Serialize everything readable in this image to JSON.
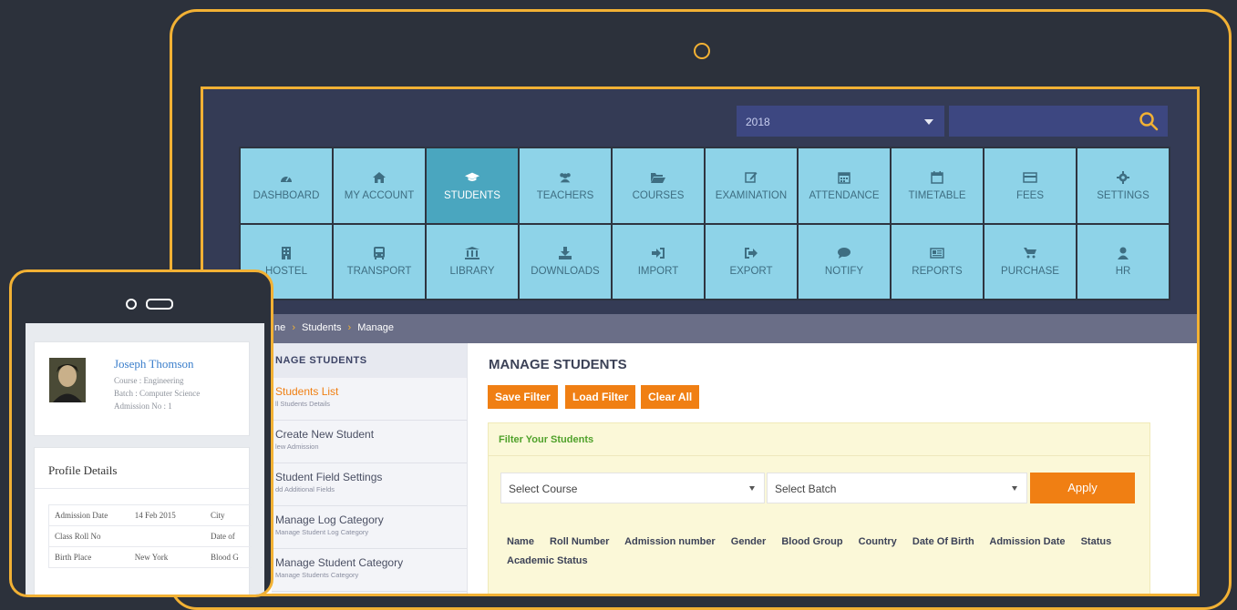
{
  "header": {
    "year_value": "2018",
    "search_placeholder": ""
  },
  "nav": {
    "row1": [
      {
        "label": "DASHBOARD",
        "icon": "dashboard-icon"
      },
      {
        "label": "MY ACCOUNT",
        "icon": "home-icon"
      },
      {
        "label": "STUDENTS",
        "icon": "graduation-cap-icon",
        "active": true
      },
      {
        "label": "TEACHERS",
        "icon": "users-icon"
      },
      {
        "label": "COURSES",
        "icon": "folder-open-icon"
      },
      {
        "label": "EXAMINATION",
        "icon": "edit-icon"
      },
      {
        "label": "ATTENDANCE",
        "icon": "calendar-icon"
      },
      {
        "label": "TIMETABLE",
        "icon": "calendar-outline-icon"
      },
      {
        "label": "FEES",
        "icon": "credit-card-icon"
      },
      {
        "label": "SETTINGS",
        "icon": "gear-icon"
      }
    ],
    "row2": [
      {
        "label": "HOSTEL",
        "icon": "building-icon"
      },
      {
        "label": "TRANSPORT",
        "icon": "bus-icon"
      },
      {
        "label": "LIBRARY",
        "icon": "institution-icon"
      },
      {
        "label": "DOWNLOADS",
        "icon": "download-icon"
      },
      {
        "label": "IMPORT",
        "icon": "sign-in-icon"
      },
      {
        "label": "EXPORT",
        "icon": "sign-out-icon"
      },
      {
        "label": "NOTIFY",
        "icon": "comment-icon"
      },
      {
        "label": "REPORTS",
        "icon": "newspaper-icon"
      },
      {
        "label": "PURCHASE",
        "icon": "shopping-cart-icon"
      },
      {
        "label": "HR",
        "icon": "user-icon"
      }
    ]
  },
  "breadcrumb": {
    "home": "ne",
    "students": "Students",
    "manage": "Manage"
  },
  "sidebar": {
    "heading": "NAGE STUDENTS",
    "items": [
      {
        "title": "Students List",
        "subtitle": "ll Students Details",
        "active": true
      },
      {
        "title": "Create New Student",
        "subtitle": "lew Admission"
      },
      {
        "title": "Student Field Settings",
        "subtitle": "dd Additional Fields"
      },
      {
        "title": "Manage Log Category",
        "subtitle": "Manage Student Log Category"
      },
      {
        "title": "Manage Student Category",
        "subtitle": "Manage Students Category"
      }
    ]
  },
  "main": {
    "title": "MANAGE STUDENTS",
    "buttons": {
      "save": "Save Filter",
      "load": "Load Filter",
      "clear": "Clear All"
    },
    "filter": {
      "heading": "Filter Your Students",
      "course_select": "Select Course",
      "batch_select": "Select Batch",
      "apply": "Apply",
      "columns": [
        "Name",
        "Roll Number",
        "Admission number",
        "Gender",
        "Blood Group",
        "Country",
        "Date Of Birth",
        "Admission Date",
        "Status",
        "Academic Status"
      ]
    }
  },
  "phone": {
    "profile": {
      "name": "Joseph Thomson",
      "course": "Course : Engineering",
      "batch": "Batch : Computer Science",
      "admission": "Admission No : 1"
    },
    "details": {
      "title": "Profile Details",
      "rows": [
        [
          "Admission Date",
          "14 Feb 2015",
          "City"
        ],
        [
          "Class Roll No",
          "",
          "Date of"
        ],
        [
          "Birth Place",
          "New York",
          "Blood G"
        ]
      ]
    }
  },
  "colors": {
    "accent": "#f2b134",
    "tile": "#8ed3e8",
    "tile_active": "#4aa6bf",
    "orange": "#f07f13"
  }
}
